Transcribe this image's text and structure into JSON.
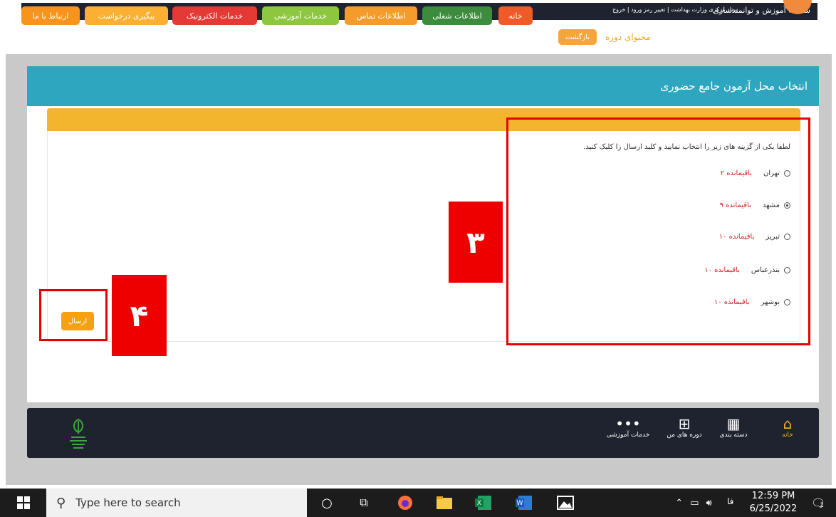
{
  "topbar": {
    "title": "سامانه آموزش و توانمندسازی",
    "links": "ستاد مرکزی وزارت بهداشت | تغییر رمز ورود | خروج"
  },
  "nav": {
    "buttons": [
      {
        "label": "خانه",
        "color": "#f05a28"
      },
      {
        "label": "اطلاعات شغلی",
        "color": "#3d8b3d"
      },
      {
        "label": "اطلاعات تماس",
        "color": "#f39c2c"
      },
      {
        "label": "خدمات آموزشی",
        "color": "#8dc63f"
      },
      {
        "label": "خدمات الکترونیک",
        "color": "#e53935"
      },
      {
        "label": "پیگیری درخواست",
        "color": "#fbb034"
      },
      {
        "label": "ارتباط با ما",
        "color": "#f7941d"
      }
    ],
    "course_content": "محتوای دوره",
    "back": "بازگشت"
  },
  "card": {
    "title": "انتخاب محل آزمون جامع حضوری",
    "instruction": "لطفا یکی از گزینه های زیر را انتخاب نمایید و کلید ارسال را کلیک کنید.",
    "options": [
      {
        "city": "تهران",
        "remaining": "باقیمانده ۲",
        "checked": false
      },
      {
        "city": "مشهد",
        "remaining": "باقیمانده ۹",
        "checked": true
      },
      {
        "city": "تبریز",
        "remaining": "باقیمانده ۱۰",
        "checked": false
      },
      {
        "city": "بندرعباس",
        "remaining": "باقیمانده ۱۰",
        "checked": false
      },
      {
        "city": "بوشهر",
        "remaining": "باقیمانده ۱۰",
        "checked": false
      }
    ],
    "submit": "ارسال"
  },
  "annotations": {
    "label3": "۳",
    "label4": "۴"
  },
  "footer": {
    "items": [
      {
        "label": "خانه",
        "icon": "home-icon"
      },
      {
        "label": "دسته بندی",
        "icon": "grid-icon"
      },
      {
        "label": "دوره های من",
        "icon": "presentation-icon"
      },
      {
        "label": "خدمات آموزشی",
        "icon": "more-icon"
      }
    ]
  },
  "taskbar": {
    "search_placeholder": "Type here to search",
    "lang": "فا",
    "time": "12:59 PM",
    "date": "6/25/2022",
    "notification_count": "1"
  }
}
